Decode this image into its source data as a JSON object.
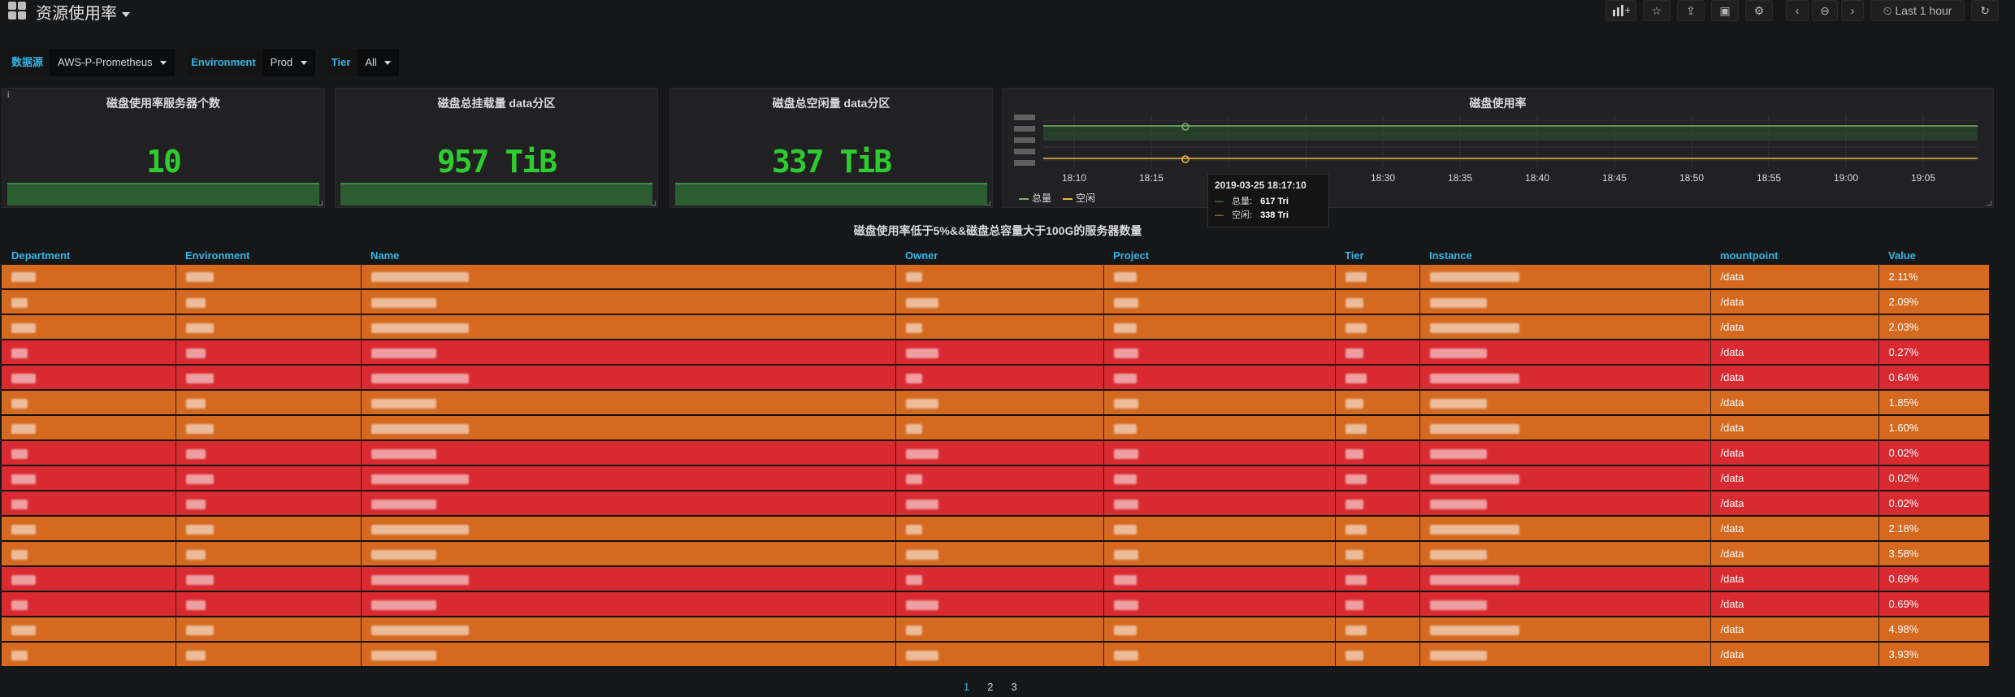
{
  "header": {
    "title": "资源使用率",
    "time_range": "Last 1 hour"
  },
  "toolbar": {
    "icons": [
      "add-panel-icon",
      "star-icon",
      "share-icon",
      "save-icon",
      "settings-icon",
      "chevron-left-icon",
      "zoom-out-icon",
      "chevron-right-icon",
      "clock-icon",
      "refresh-icon"
    ]
  },
  "variables": [
    {
      "label": "数据源",
      "value": "AWS-P-Prometheus"
    },
    {
      "label": "Environment",
      "value": "Prod"
    },
    {
      "label": "Tier",
      "value": "All"
    }
  ],
  "panels": {
    "stat1": {
      "title": "磁盘使用率服务器个数",
      "value": "10"
    },
    "stat2": {
      "title": "磁盘总挂载量 data分区",
      "value": "957 TiB"
    },
    "stat3": {
      "title": "磁盘总空闲量 data分区",
      "value": "337 TiB"
    },
    "graph": {
      "title": "磁盘使用率",
      "x_ticks": [
        "18:10",
        "18:15",
        "18:20",
        "18:25",
        "18:30",
        "18:35",
        "18:40",
        "18:45",
        "18:50",
        "18:55",
        "19:00",
        "19:05"
      ],
      "legend": [
        {
          "name": "总量",
          "color": "#7eb26d"
        },
        {
          "name": "空闲",
          "color": "#eab839"
        }
      ],
      "tooltip": {
        "time": "2019-03-25 18:17:10",
        "rows": [
          {
            "name": "总量:",
            "value": "617 Tri"
          },
          {
            "name": "空闲:",
            "value": "338 Tri"
          }
        ]
      }
    }
  },
  "table": {
    "title": "磁盘使用率低于5%&&磁盘总容量大于100G的服务器数量",
    "columns": [
      "Department",
      "Environment",
      "Name",
      "Owner",
      "Project",
      "Tier",
      "Instance",
      "mountpoint",
      "Value"
    ],
    "rows": [
      {
        "status": "orange",
        "mountpoint": "/data",
        "value": "2.11%"
      },
      {
        "status": "orange",
        "mountpoint": "/data",
        "value": "2.09%"
      },
      {
        "status": "orange",
        "mountpoint": "/data",
        "value": "2.03%"
      },
      {
        "status": "red",
        "mountpoint": "/data",
        "value": "0.27%"
      },
      {
        "status": "red",
        "mountpoint": "/data",
        "value": "0.64%"
      },
      {
        "status": "orange",
        "mountpoint": "/data",
        "value": "1.85%"
      },
      {
        "status": "orange",
        "mountpoint": "/data",
        "value": "1.60%"
      },
      {
        "status": "red",
        "mountpoint": "/data",
        "value": "0.02%"
      },
      {
        "status": "red",
        "mountpoint": "/data",
        "value": "0.02%"
      },
      {
        "status": "red",
        "mountpoint": "/data",
        "value": "0.02%"
      },
      {
        "status": "orange",
        "mountpoint": "/data",
        "value": "2.18%"
      },
      {
        "status": "orange",
        "mountpoint": "/data",
        "value": "3.58%"
      },
      {
        "status": "red",
        "mountpoint": "/data",
        "value": "0.69%"
      },
      {
        "status": "red",
        "mountpoint": "/data",
        "value": "0.69%"
      },
      {
        "status": "orange",
        "mountpoint": "/data",
        "value": "4.98%"
      },
      {
        "status": "orange",
        "mountpoint": "/data",
        "value": "3.93%"
      }
    ]
  },
  "pagination": {
    "pages": [
      "1",
      "2",
      "3"
    ],
    "current": "1"
  },
  "colors": {
    "orange": "#d4691f",
    "red": "#d82a30",
    "accent": "#33b5e5",
    "stat_green": "#2ecc2e"
  }
}
